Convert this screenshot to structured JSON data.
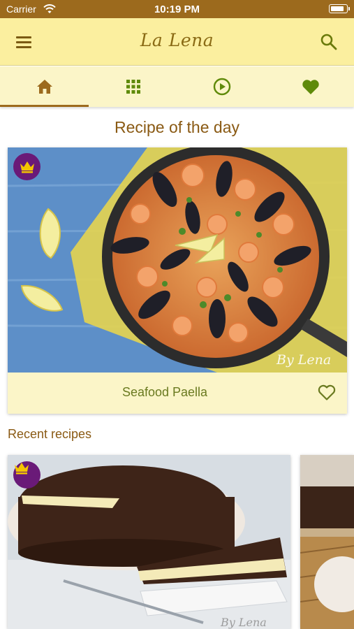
{
  "status_bar": {
    "carrier": "Carrier",
    "time": "10:19 PM",
    "battery_level": 0.9
  },
  "app_bar": {
    "logo_text": "La Lena",
    "menu_icon": "hamburger-menu-icon",
    "search_icon": "search-icon"
  },
  "tabs": [
    {
      "icon": "home-icon",
      "active": true
    },
    {
      "icon": "grid-icon",
      "active": false
    },
    {
      "icon": "play-circle-icon",
      "active": false
    },
    {
      "icon": "heart-icon",
      "active": false
    }
  ],
  "recipe_of_day": {
    "section_title": "Recipe of the day",
    "name": "Seafood Paella",
    "premium": true,
    "watermark": "By Lena"
  },
  "recent": {
    "section_title": "Recent recipes",
    "items": [
      {
        "premium": true
      },
      {
        "premium": false
      }
    ]
  },
  "colors": {
    "status_bar": "#9c6a1d",
    "app_bar": "#fbef9f",
    "tab_bar": "#fbf5c8",
    "accent_brown": "#9c6a1d",
    "accent_green": "#5f8a0a",
    "crown_badge": "#6a1a78",
    "crown": "#f4c400"
  }
}
